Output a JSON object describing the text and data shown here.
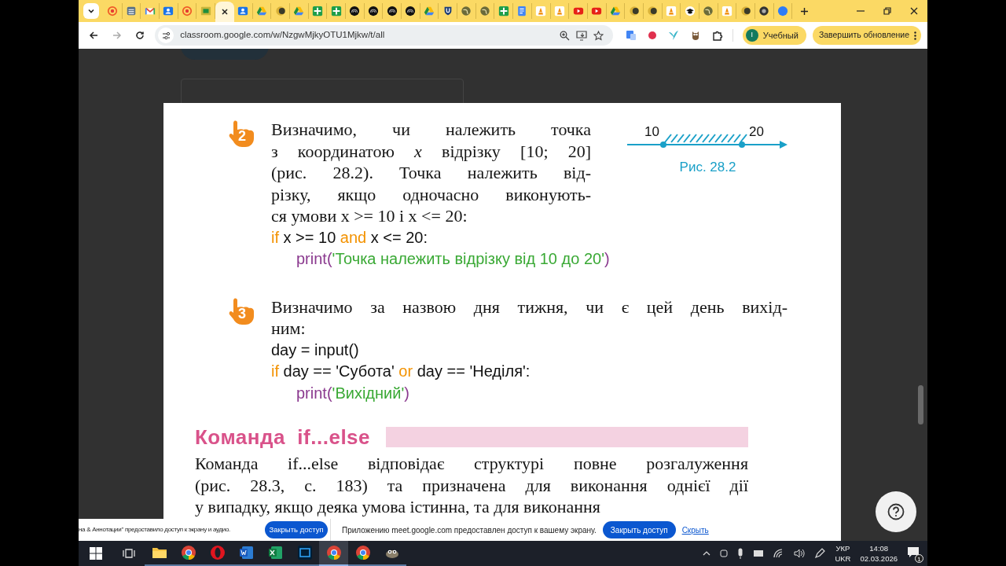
{
  "browser": {
    "tabs": [
      {
        "kind": "target",
        "selected": false
      },
      {
        "kind": "layers",
        "selected": false
      },
      {
        "kind": "mail",
        "selected": false
      },
      {
        "kind": "contact",
        "selected": false
      },
      {
        "kind": "target",
        "selected": false
      },
      {
        "kind": "easel",
        "selected": false
      },
      {
        "selected": true
      },
      {
        "kind": "contact",
        "selected": false
      },
      {
        "kind": "drive",
        "selected": false
      },
      {
        "kind": "crescent",
        "selected": false
      },
      {
        "kind": "drive",
        "selected": false
      },
      {
        "kind": "sheets",
        "selected": false
      },
      {
        "kind": "sheets",
        "selected": false
      },
      {
        "kind": "spiral",
        "selected": false
      },
      {
        "kind": "spiral",
        "selected": false
      },
      {
        "kind": "spiral",
        "selected": false
      },
      {
        "kind": "spiral",
        "selected": false
      },
      {
        "kind": "drive",
        "selected": false
      },
      {
        "kind": "shield",
        "selected": false
      },
      {
        "kind": "globe",
        "selected": false
      },
      {
        "kind": "globe",
        "selected": false
      },
      {
        "kind": "sheets",
        "selected": false
      },
      {
        "kind": "docs",
        "selected": false
      },
      {
        "kind": "cone",
        "selected": false
      },
      {
        "kind": "cone",
        "selected": false
      },
      {
        "kind": "play",
        "selected": false
      },
      {
        "kind": "play",
        "selected": false
      },
      {
        "kind": "drive",
        "selected": false
      },
      {
        "kind": "crescent",
        "selected": false
      },
      {
        "kind": "crescent",
        "selected": false
      },
      {
        "kind": "cone",
        "selected": false
      },
      {
        "kind": "cap",
        "selected": false
      },
      {
        "kind": "globe",
        "selected": false
      },
      {
        "kind": "cone",
        "selected": false
      },
      {
        "kind": "crescent",
        "selected": false
      },
      {
        "kind": "ring",
        "selected": false
      },
      {
        "kind": "disc",
        "selected": false
      }
    ],
    "url": "classroom.google.com/w/NzgwMjkyOTU1Mjkw/t/all",
    "profile": {
      "initial": "I",
      "name": "Учебный"
    },
    "update_button": "Завершить обновление"
  },
  "textbook": {
    "examples": [
      {
        "number": "2",
        "lines": [
          "Визначимо, чи належить точка",
          "з координатою *x* відрізку [10; 20]",
          "(рис. 28.2). Точка належить від-",
          "різку, якщо одночасно виконують-",
          "ся умови x >= 10 і x <= 20:"
        ],
        "code": [
          {
            "indent": false,
            "tokens": [
              {
                "kind": "keyword",
                "text": "if"
              },
              {
                "kind": "plain",
                "text": " x >= 10 "
              },
              {
                "kind": "keyword",
                "text": "and"
              },
              {
                "kind": "plain",
                "text": " x <= 20:"
              }
            ]
          },
          {
            "indent": true,
            "tokens": [
              {
                "kind": "function",
                "text": "print("
              },
              {
                "kind": "string",
                "text": "'Точка належить відрізку від 10 до 20'"
              },
              {
                "kind": "function",
                "text": ")"
              }
            ]
          }
        ],
        "figure": {
          "left_label": "10",
          "right_label": "20",
          "caption": "Рис. 28.2"
        }
      },
      {
        "number": "3",
        "lines": [
          "Визначимо за назвою дня тижня, чи є цей день вихід-",
          "ним:"
        ],
        "code": [
          {
            "indent": false,
            "tokens": [
              {
                "kind": "plain",
                "text": "day = input()"
              }
            ]
          },
          {
            "indent": false,
            "tokens": [
              {
                "kind": "keyword",
                "text": "if"
              },
              {
                "kind": "plain",
                "text": " day == 'Субота' "
              },
              {
                "kind": "keyword",
                "text": "or"
              },
              {
                "kind": "plain",
                "text": " day == 'Неділя':"
              }
            ]
          },
          {
            "indent": true,
            "tokens": [
              {
                "kind": "function",
                "text": "print("
              },
              {
                "kind": "string",
                "text": "'Вихідний'"
              },
              {
                "kind": "function",
                "text": ")"
              }
            ]
          }
        ]
      }
    ],
    "section_title": "Команда  if...else",
    "paragraph": [
      "Команда if...else відповідає структурі повне розгалуження",
      "(рис. 28.3, с. 183) та призначена для виконання однієї дії",
      "у випадку, якщо деяка умова істинна, та для виконання"
    ]
  },
  "share_bars": [
    {
      "message": "на & Аннотации\" предоставило доступ к экрану и аудио.",
      "button": "Закрыть доступ"
    },
    {
      "message": "Приложению meet.google.com предоставлен доступ к вашему экрану.",
      "button": "Закрыть доступ",
      "link": "Скрыть"
    }
  ],
  "taskbar": {
    "apps": [
      {
        "kind": "folder",
        "selected": false
      },
      {
        "kind": "chrome",
        "selected": false
      },
      {
        "kind": "opera",
        "selected": false
      },
      {
        "kind": "word",
        "selected": false
      },
      {
        "kind": "excel",
        "selected": false
      },
      {
        "kind": "photo",
        "selected": false
      },
      {
        "kind": "chrome",
        "selected": true
      },
      {
        "kind": "chrome",
        "selected": false
      },
      {
        "kind": "gimp",
        "selected": false
      }
    ],
    "language": [
      "УКР",
      "UKR"
    ],
    "time": "14:08",
    "date": "02.03.2026",
    "notifications": "1"
  }
}
